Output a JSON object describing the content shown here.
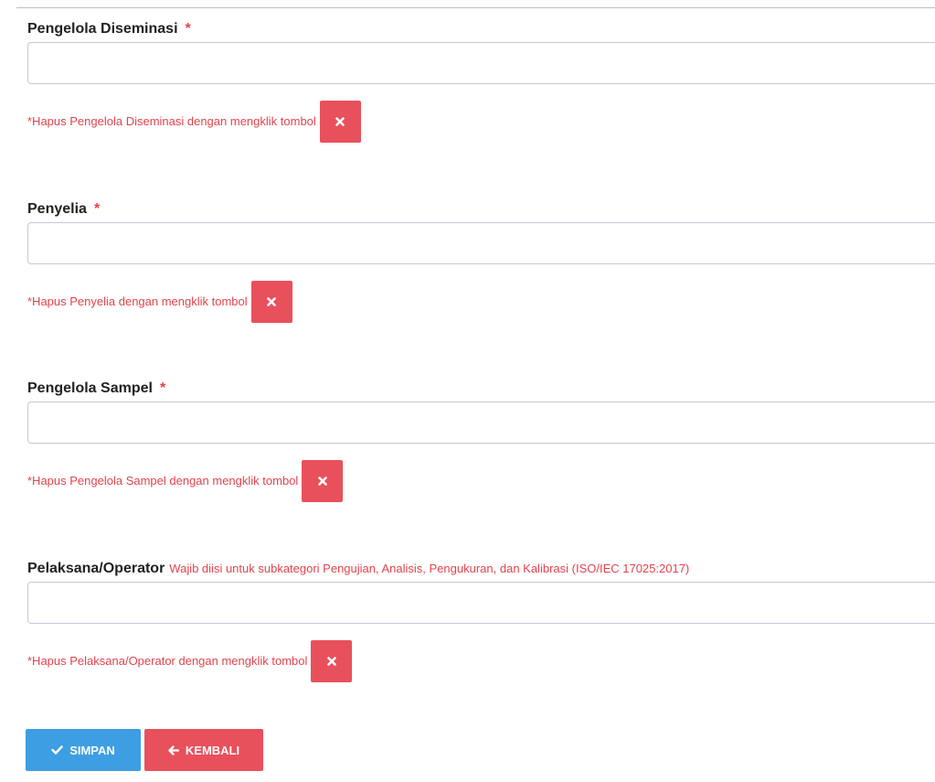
{
  "form": {
    "fields": [
      {
        "label": "Pengelola Diseminasi",
        "required_mark": "*",
        "value": "",
        "delete_hint": "*Hapus Pengelola Diseminasi dengan mengklik tombol"
      },
      {
        "label": "Penyelia",
        "required_mark": "*",
        "value": "",
        "delete_hint": "*Hapus Penyelia dengan mengklik tombol"
      },
      {
        "label": "Pengelola Sampel",
        "required_mark": "*",
        "value": "",
        "delete_hint": "*Hapus Pengelola Sampel dengan mengklik tombol"
      },
      {
        "label": "Pelaksana/Operator",
        "note": "Wajib diisi untuk subkategori Pengujian, Analisis, Pengukuran, dan Kalibrasi (ISO/IEC 17025:2017)",
        "value": "",
        "delete_hint": "*Hapus Pelaksana/Operator dengan mengklik tombol"
      }
    ]
  },
  "actions": {
    "save_label": "SIMPAN",
    "back_label": "KEMBALI"
  },
  "icons": {
    "delete": "times-icon",
    "save": "check-icon",
    "back": "arrow-left-icon"
  },
  "colors": {
    "danger": "#e8505b",
    "primary": "#3d9ee3",
    "required": "#e3434d"
  }
}
